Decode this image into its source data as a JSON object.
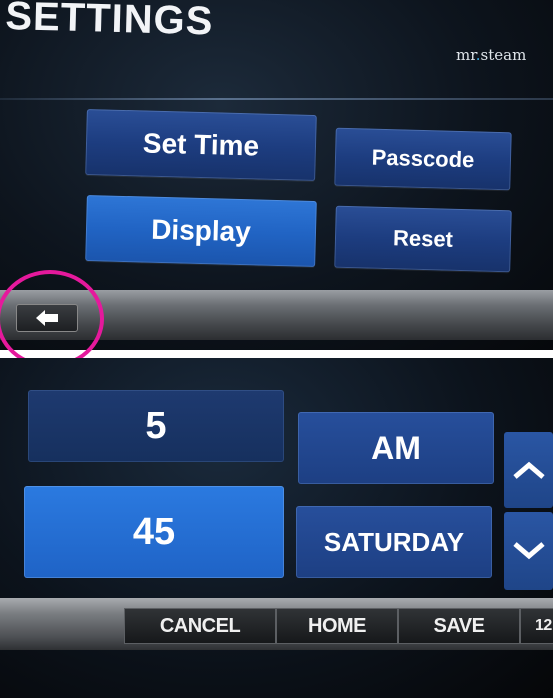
{
  "settings_screen": {
    "title": "SETTINGS",
    "brand": {
      "prefix": "mr",
      "dot": ".",
      "suffix": "steam"
    },
    "buttons": {
      "set_time": "Set Time",
      "passcode": "Passcode",
      "display": "Display",
      "reset": "Reset"
    },
    "back_icon": "left-arrow-icon",
    "highlight_color": "#e5199c"
  },
  "set_time_screen": {
    "hour": "5",
    "minute": "45",
    "meridiem": "AM",
    "day": "SATURDAY",
    "up_icon": "chevron-up-icon",
    "down_icon": "chevron-down-icon",
    "toolbar": {
      "cancel": "CANCEL",
      "home": "HOME",
      "save": "SAVE",
      "clock_mode": "12"
    }
  },
  "colors": {
    "button_dark": "#1d3d80",
    "button_bright": "#2164c4",
    "background": "#0a0c10"
  }
}
